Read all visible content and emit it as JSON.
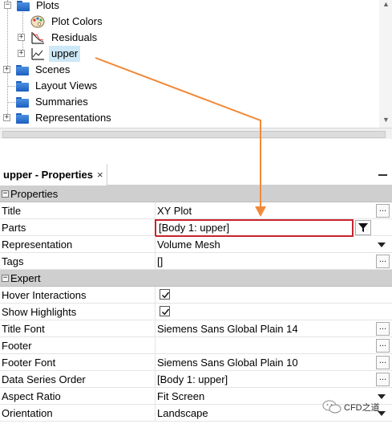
{
  "tree": {
    "items": [
      {
        "label": "Plots",
        "icon": "folder-icon",
        "expander": "−"
      },
      {
        "label": "Plot Colors",
        "icon": "palette-icon"
      },
      {
        "label": "Residuals",
        "icon": "residuals-plot-icon",
        "expander": "+"
      },
      {
        "label": "upper",
        "icon": "xy-plot-icon",
        "expander": "+",
        "selected": true
      },
      {
        "label": "Scenes",
        "icon": "folder-icon",
        "expander": "+"
      },
      {
        "label": "Layout Views",
        "icon": "folder-icon"
      },
      {
        "label": "Summaries",
        "icon": "folder-icon"
      },
      {
        "label": "Representations",
        "icon": "folder-icon",
        "expander": "+"
      }
    ]
  },
  "properties": {
    "tab_label": "upper - Properties",
    "tab_close": "×",
    "sections": [
      {
        "label": "Properties",
        "toggle": "−"
      },
      {
        "label": "Expert",
        "toggle": "−"
      }
    ],
    "rows": [
      {
        "name": "Title",
        "value": "XY Plot",
        "control": "ellipsis"
      },
      {
        "name": "Parts",
        "value": "[Body 1: upper]",
        "control": "filter",
        "highlighted": true
      },
      {
        "name": "Representation",
        "value": "Volume Mesh",
        "control": "dropdown"
      },
      {
        "name": "Tags",
        "value": "[]",
        "control": "ellipsis"
      },
      {
        "name": "Hover Interactions",
        "value": "",
        "control": "checkbox",
        "checked": true
      },
      {
        "name": "Show Highlights",
        "value": "",
        "control": "checkbox",
        "checked": true
      },
      {
        "name": "Title Font",
        "value": "Siemens Sans Global Plain 14",
        "control": "ellipsis"
      },
      {
        "name": "Footer",
        "value": "",
        "control": "ellipsis"
      },
      {
        "name": "Footer Font",
        "value": "Siemens Sans Global Plain 10",
        "control": "ellipsis"
      },
      {
        "name": "Data Series Order",
        "value": "[Body 1: upper]",
        "control": "ellipsis"
      },
      {
        "name": "Aspect Ratio",
        "value": "Fit Screen",
        "control": "dropdown"
      },
      {
        "name": "Orientation",
        "value": "Landscape",
        "control": "dropdown"
      }
    ],
    "ellipsis_label": "...",
    "highlight_color": "#c8242f",
    "arrow_color": "#f08a3a"
  },
  "watermark": {
    "text": "CFD之道"
  }
}
